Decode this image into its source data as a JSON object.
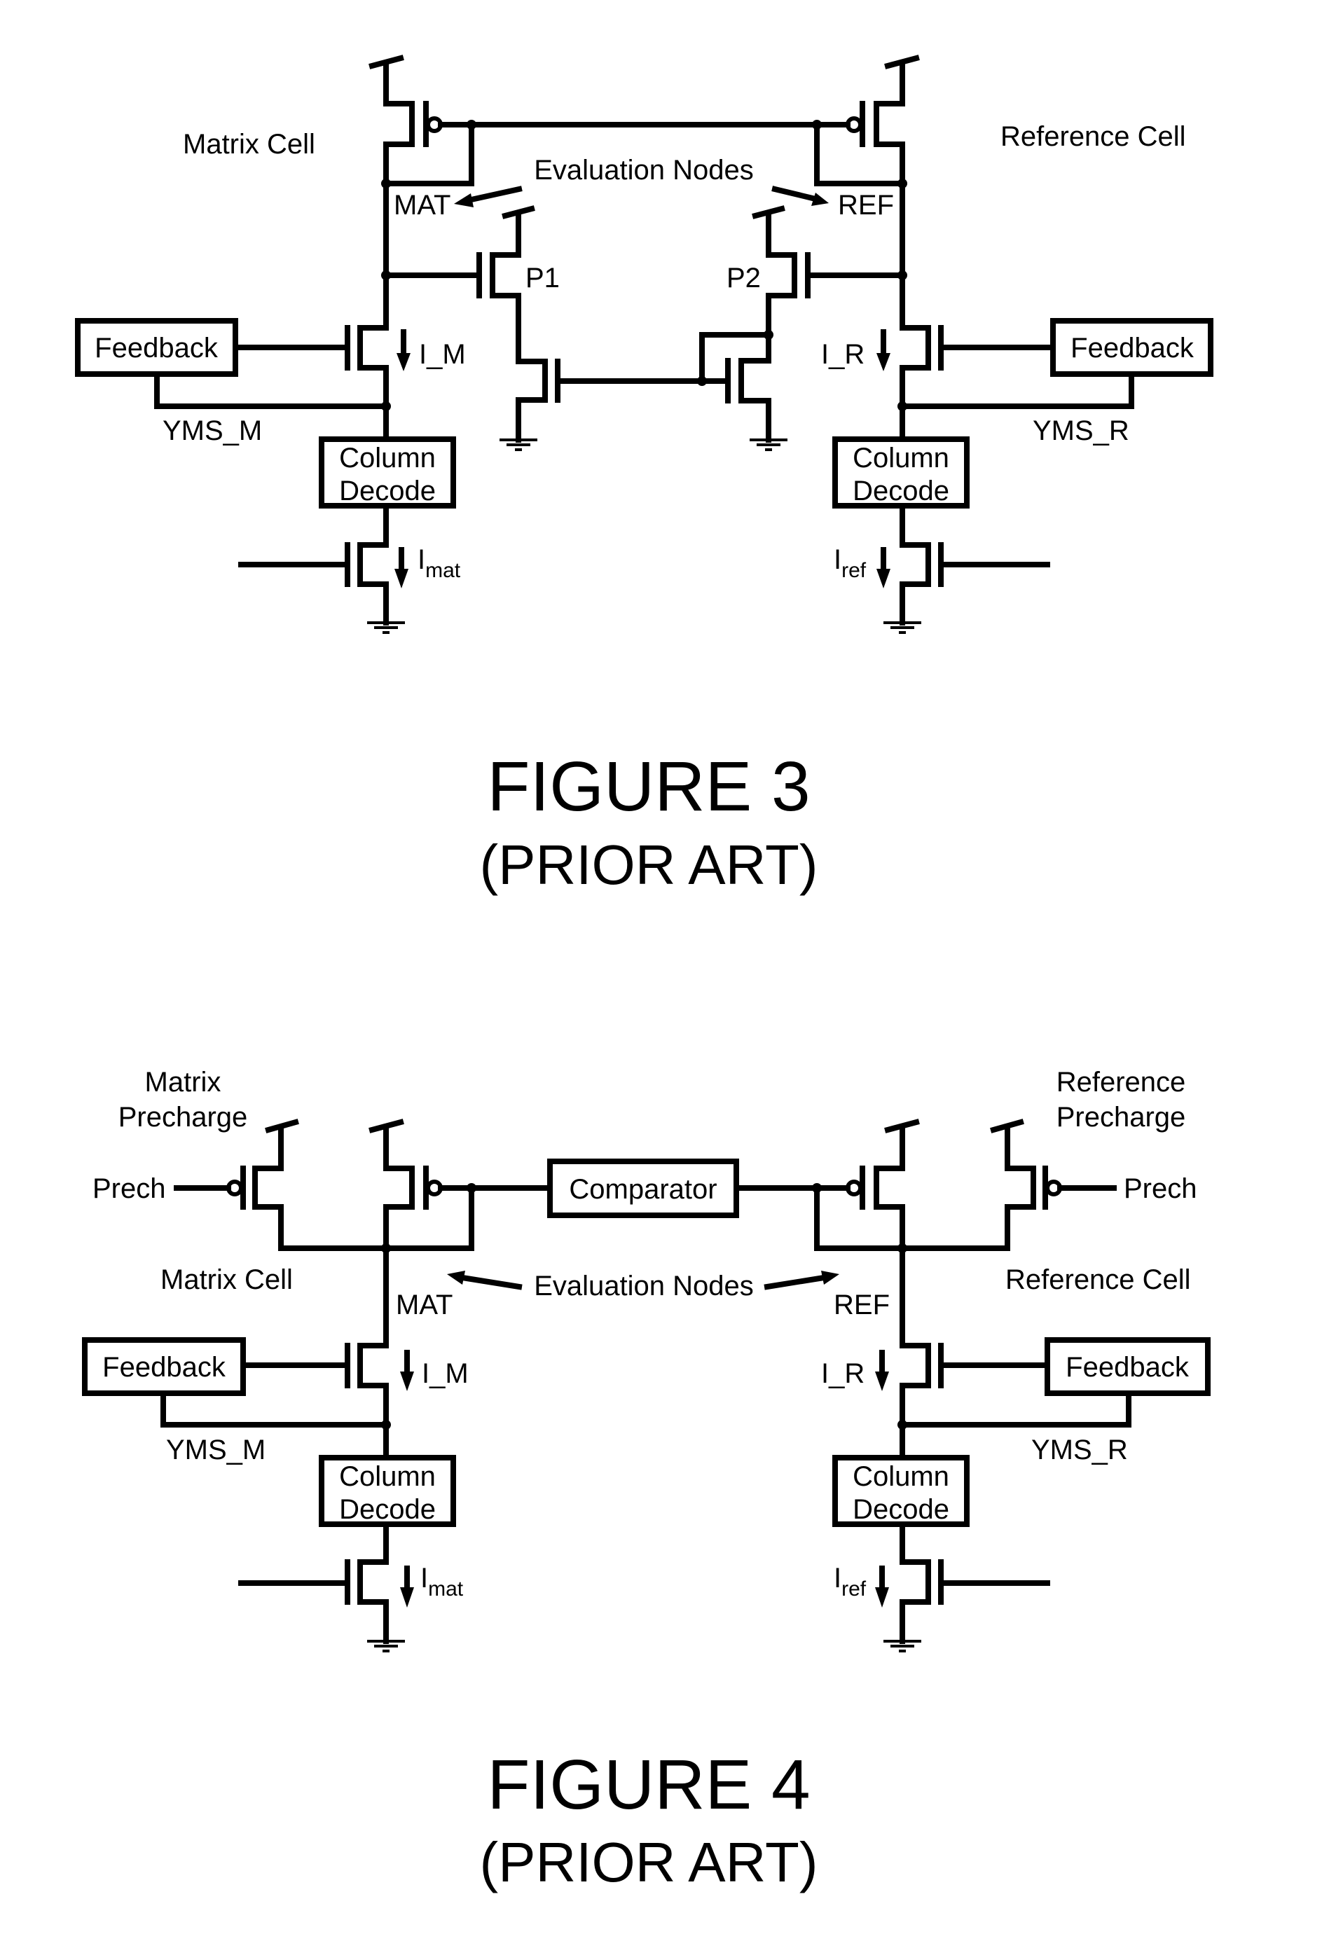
{
  "figures": [
    {
      "id": "figure-3",
      "caption": "FIGURE 3",
      "subcaption": "(PRIOR ART)",
      "labels": {
        "matrix_cell": "Matrix Cell",
        "reference_cell": "Reference Cell",
        "evaluation_nodes": "Evaluation Nodes",
        "mat": "MAT",
        "ref": "REF",
        "p1": "P1",
        "p2": "P2",
        "i_m": "I_M",
        "i_r": "I_R",
        "yms_m": "YMS_M",
        "yms_r": "YMS_R",
        "i_mat_main": "I",
        "i_mat_sub": "mat",
        "i_ref_main": "I",
        "i_ref_sub": "ref"
      },
      "blocks": {
        "feedback_left": "Feedback",
        "feedback_right": "Feedback",
        "column_decode_left": [
          "Column",
          "Decode"
        ],
        "column_decode_right": [
          "Column",
          "Decode"
        ]
      }
    },
    {
      "id": "figure-4",
      "caption": "FIGURE 4",
      "subcaption": "(PRIOR ART)",
      "labels": {
        "matrix_precharge": [
          "Matrix",
          "Precharge"
        ],
        "reference_precharge": [
          "Reference",
          "Precharge"
        ],
        "prech_left": "Prech",
        "prech_right": "Prech",
        "matrix_cell": "Matrix Cell",
        "reference_cell": "Reference Cell",
        "evaluation_nodes": "Evaluation Nodes",
        "mat": "MAT",
        "ref": "REF",
        "i_m": "I_M",
        "i_r": "I_R",
        "yms_m": "YMS_M",
        "yms_r": "YMS_R",
        "i_mat_main": "I",
        "i_mat_sub": "mat",
        "i_ref_main": "I",
        "i_ref_sub": "ref"
      },
      "blocks": {
        "comparator": "Comparator",
        "feedback_left": "Feedback",
        "feedback_right": "Feedback",
        "column_decode_left": [
          "Column",
          "Decode"
        ],
        "column_decode_right": [
          "Column",
          "Decode"
        ]
      }
    }
  ]
}
